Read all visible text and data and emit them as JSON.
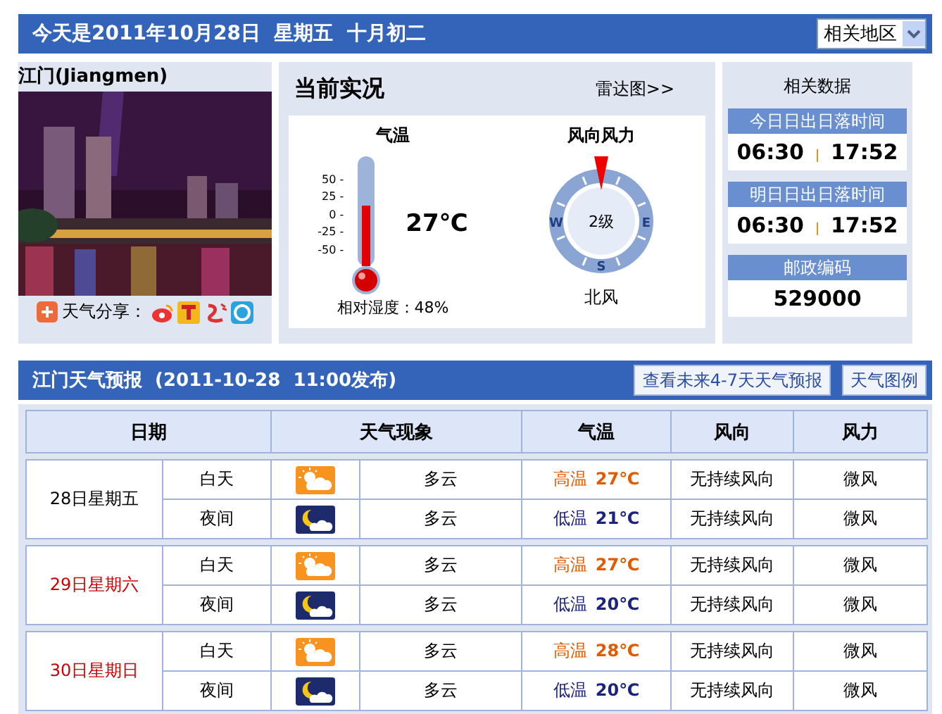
{
  "header": {
    "title": "今天是2011年10月28日  星期五  十月初二",
    "region_select": "相关地区"
  },
  "city": {
    "name": "江门(Jiangmen)",
    "share_label": "天气分享："
  },
  "current": {
    "title": "当前实况",
    "radar_link": "雷达图>>",
    "temperature": {
      "title": "气温",
      "scale": [
        "50 -",
        "25 -",
        "0 -",
        "-25 -",
        "-50 -"
      ],
      "level": 0.6,
      "reading": "27℃",
      "humidity": "相对湿度：48%"
    },
    "wind": {
      "title": "风向风力",
      "compass": [
        "W",
        "E",
        "S"
      ],
      "force": "2级",
      "direction": "北风"
    }
  },
  "related": {
    "title": "相关数据",
    "blocks": [
      {
        "heading": "今日日出日落时间",
        "values": [
          "06:30",
          "17:52"
        ]
      },
      {
        "heading": "明日日出日落时间",
        "values": [
          "06:30",
          "17:52"
        ]
      },
      {
        "heading": "邮政编码",
        "values": [
          "529000"
        ]
      }
    ]
  },
  "forecast": {
    "title": "江门天气预报  (2011-10-28  11:00发布)",
    "buttons": [
      "查看未来4-7天天气预报",
      "天气图例"
    ],
    "columns": [
      "日期",
      "天气现象",
      "气温",
      "风向",
      "风力"
    ],
    "days": [
      {
        "date": "28日星期五",
        "weekend": false,
        "periods": [
          {
            "kind": "day",
            "label": "白天",
            "weather": "多云",
            "temp_label": "高温",
            "temp": "27℃",
            "wind_dir": "无持续风向",
            "wind_force": "微风"
          },
          {
            "kind": "night",
            "label": "夜间",
            "weather": "多云",
            "temp_label": "低温",
            "temp": "21℃",
            "wind_dir": "无持续风向",
            "wind_force": "微风"
          }
        ]
      },
      {
        "date": "29日星期六",
        "weekend": true,
        "periods": [
          {
            "kind": "day",
            "label": "白天",
            "weather": "多云",
            "temp_label": "高温",
            "temp": "27℃",
            "wind_dir": "无持续风向",
            "wind_force": "微风"
          },
          {
            "kind": "night",
            "label": "夜间",
            "weather": "多云",
            "temp_label": "低温",
            "temp": "20℃",
            "wind_dir": "无持续风向",
            "wind_force": "微风"
          }
        ]
      },
      {
        "date": "30日星期日",
        "weekend": true,
        "periods": [
          {
            "kind": "day",
            "label": "白天",
            "weather": "多云",
            "temp_label": "高温",
            "temp": "28℃",
            "wind_dir": "无持续风向",
            "wind_force": "微风"
          },
          {
            "kind": "night",
            "label": "夜间",
            "weather": "多云",
            "temp_label": "低温",
            "temp": "20℃",
            "wind_dir": "无持续风向",
            "wind_force": "微风"
          }
        ]
      }
    ]
  }
}
